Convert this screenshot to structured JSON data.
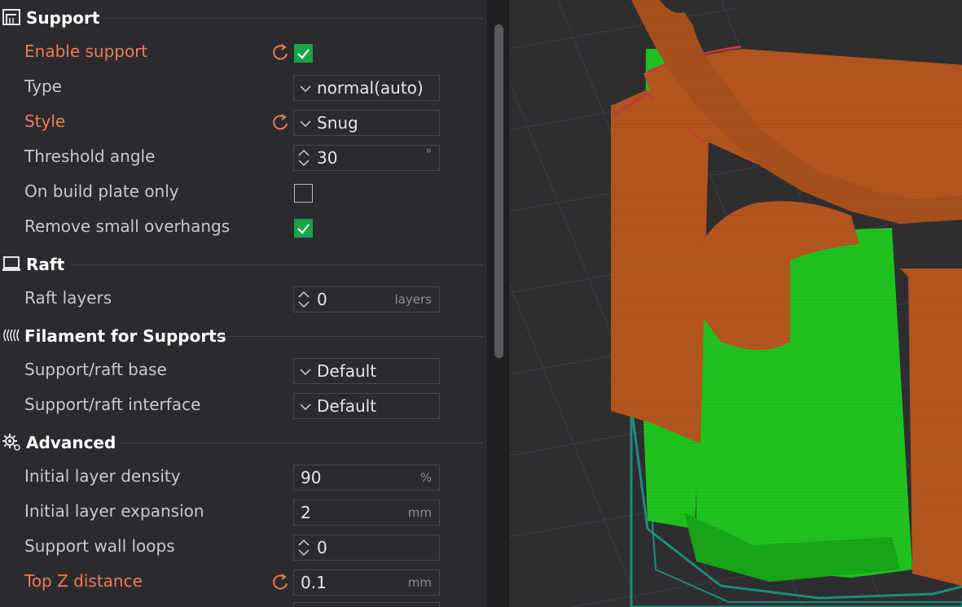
{
  "sections": {
    "support": "Support",
    "raft": "Raft",
    "filament": "Filament for Supports",
    "advanced": "Advanced"
  },
  "rows": {
    "enable_support": {
      "label": "Enable support",
      "checked": true
    },
    "type": {
      "label": "Type",
      "value": "normal(auto)"
    },
    "style": {
      "label": "Style",
      "value": "Snug"
    },
    "threshold_angle": {
      "label": "Threshold angle",
      "value": "30",
      "unit": "°"
    },
    "build_plate_only": {
      "label": "On build plate only",
      "checked": false
    },
    "remove_small_overhangs": {
      "label": "Remove small overhangs",
      "checked": true
    },
    "raft_layers": {
      "label": "Raft layers",
      "value": "0",
      "unit": "layers"
    },
    "support_raft_base": {
      "label": "Support/raft base",
      "value": "Default"
    },
    "support_raft_interface": {
      "label": "Support/raft interface",
      "value": "Default"
    },
    "initial_layer_density": {
      "label": "Initial layer density",
      "value": "90",
      "unit": "%"
    },
    "initial_layer_expansion": {
      "label": "Initial layer expansion",
      "value": "2",
      "unit": "mm"
    },
    "support_wall_loops": {
      "label": "Support wall loops",
      "value": "0"
    },
    "top_z_distance": {
      "label": "Top Z distance",
      "value": "0.1",
      "unit": "mm"
    }
  },
  "colors": {
    "modified_label": "#ef7b54",
    "check_on": "#19a34a",
    "model_orange": "#b3551e",
    "support_green": "#1fc21f"
  },
  "icons": [
    "support-icon",
    "raft-icon",
    "filament-icon",
    "advanced-gear-icon",
    "reset-icon",
    "chevron-down-icon",
    "spin-icon",
    "checkmark-icon"
  ]
}
